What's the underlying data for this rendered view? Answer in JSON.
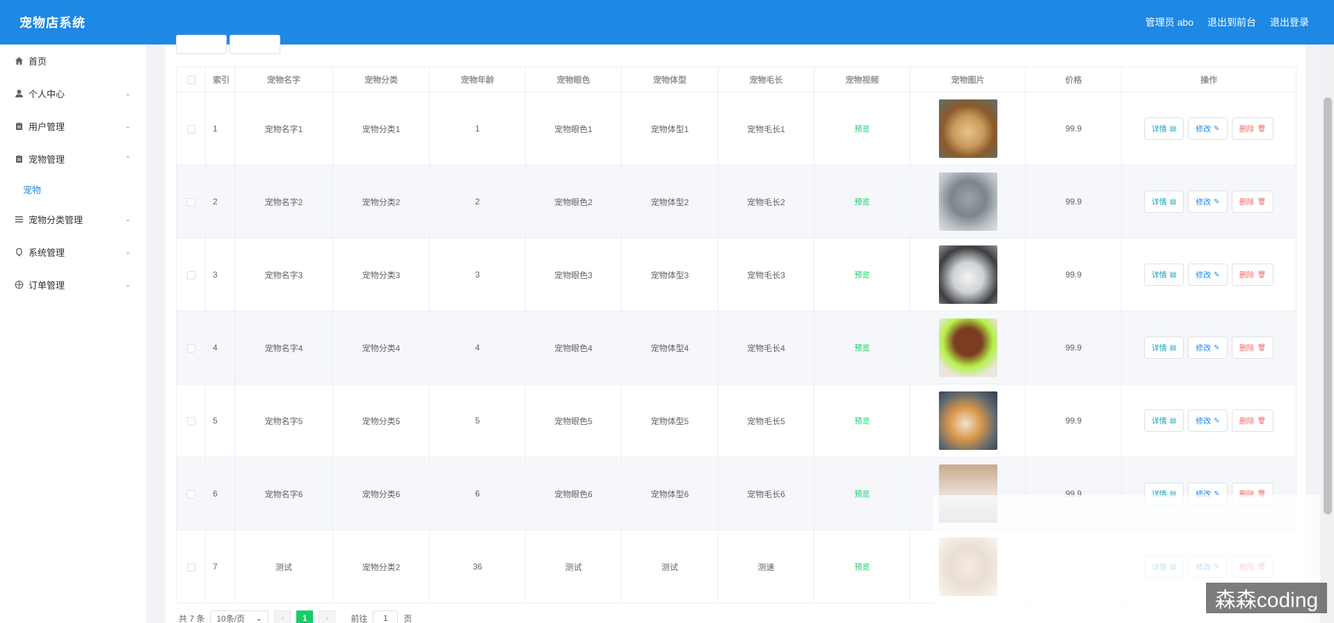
{
  "header": {
    "app_title": "宠物店系统",
    "admin_label": "管理员 abo",
    "exit_front_label": "退出到前台",
    "logout_label": "退出登录",
    "bg_color": "#1e88e5"
  },
  "sidebar": {
    "items": [
      {
        "label": "首页",
        "icon": "home-icon"
      },
      {
        "label": "个人中心",
        "icon": "user-icon"
      },
      {
        "label": "用户管理",
        "icon": "clipboard-icon"
      },
      {
        "label": "宠物管理",
        "icon": "clipboard-icon",
        "expanded": true,
        "subitems": [
          {
            "label": "宠物"
          }
        ]
      },
      {
        "label": "宠物分类管理",
        "icon": "list-icon"
      },
      {
        "label": "系统管理",
        "icon": "lock-icon"
      },
      {
        "label": "订单管理",
        "icon": "globe-icon"
      }
    ]
  },
  "table": {
    "columns": [
      "",
      "索引",
      "宠物名字",
      "宠物分类",
      "宠物年龄",
      "宠物眼色",
      "宠物体型",
      "宠物毛长",
      "宠物视频",
      "宠物图片",
      "价格",
      "操作"
    ],
    "rows": [
      {
        "index": "1",
        "name": "宠物名字1",
        "category": "宠物分类1",
        "age": "1",
        "eye": "宠物眼色1",
        "body": "宠物体型1",
        "fur": "宠物毛长1",
        "video": "预览",
        "price": "99.9",
        "image": "cat-toy"
      },
      {
        "index": "2",
        "name": "宠物名字2",
        "category": "宠物分类2",
        "age": "2",
        "eye": "宠物眼色2",
        "body": "宠物体型2",
        "fur": "宠物毛长2",
        "video": "预览",
        "price": "99.9",
        "image": "gray-cat"
      },
      {
        "index": "3",
        "name": "宠物名字3",
        "category": "宠物分类3",
        "age": "3",
        "eye": "宠物眼色3",
        "body": "宠物体型3",
        "fur": "宠物毛长3",
        "video": "预览",
        "price": "99.9",
        "image": "husky"
      },
      {
        "index": "4",
        "name": "宠物名字4",
        "category": "宠物分类4",
        "age": "4",
        "eye": "宠物眼色4",
        "body": "宠物体型4",
        "fur": "宠物毛长4",
        "video": "预览",
        "price": "99.9",
        "image": "poodle"
      },
      {
        "index": "5",
        "name": "宠物名字5",
        "category": "宠物分类5",
        "age": "5",
        "eye": "宠物眼色5",
        "body": "宠物体型5",
        "fur": "宠物毛长5",
        "video": "预览",
        "price": "99.9",
        "image": "kittens"
      },
      {
        "index": "6",
        "name": "宠物名字6",
        "category": "宠物分类6",
        "age": "6",
        "eye": "宠物眼色6",
        "body": "宠物体型6",
        "fur": "宠物毛长6",
        "video": "预览",
        "price": "99.9",
        "image": "cat-sleep"
      },
      {
        "index": "7",
        "name": "测试",
        "category": "宠物分类2",
        "age": "36",
        "eye": "测试",
        "body": "测试",
        "fur": "测速",
        "video": "预览",
        "price": "",
        "image": "dog-blur"
      }
    ],
    "actions": {
      "detail": "详情",
      "edit": "修改",
      "delete": "删除"
    }
  },
  "pagination": {
    "total": "共 7 条",
    "page_size": "10条/页",
    "current_page": "1",
    "goto_prefix": "前往",
    "goto_value": "1",
    "goto_suffix": "页"
  },
  "watermark": "森森coding"
}
